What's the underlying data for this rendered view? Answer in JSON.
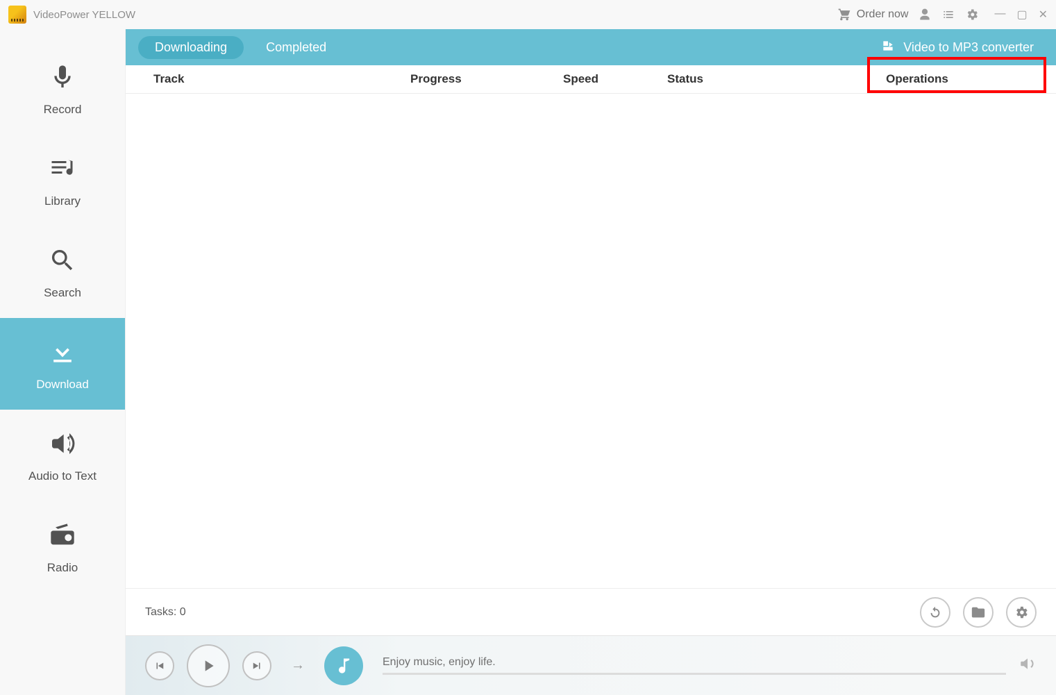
{
  "app": {
    "title": "VideoPower YELLOW"
  },
  "titlebar": {
    "order_now": "Order now"
  },
  "sidebar": {
    "items": [
      {
        "label": "Record"
      },
      {
        "label": "Library"
      },
      {
        "label": "Search"
      },
      {
        "label": "Download"
      },
      {
        "label": "Audio to Text"
      },
      {
        "label": "Radio"
      }
    ]
  },
  "tabs": {
    "downloading": "Downloading",
    "completed": "Completed",
    "converter": "Video to MP3 converter"
  },
  "columns": {
    "track": "Track",
    "progress": "Progress",
    "speed": "Speed",
    "status": "Status",
    "operations": "Operations"
  },
  "bottom": {
    "tasks": "Tasks: 0"
  },
  "player": {
    "message": "Enjoy music, enjoy life."
  }
}
